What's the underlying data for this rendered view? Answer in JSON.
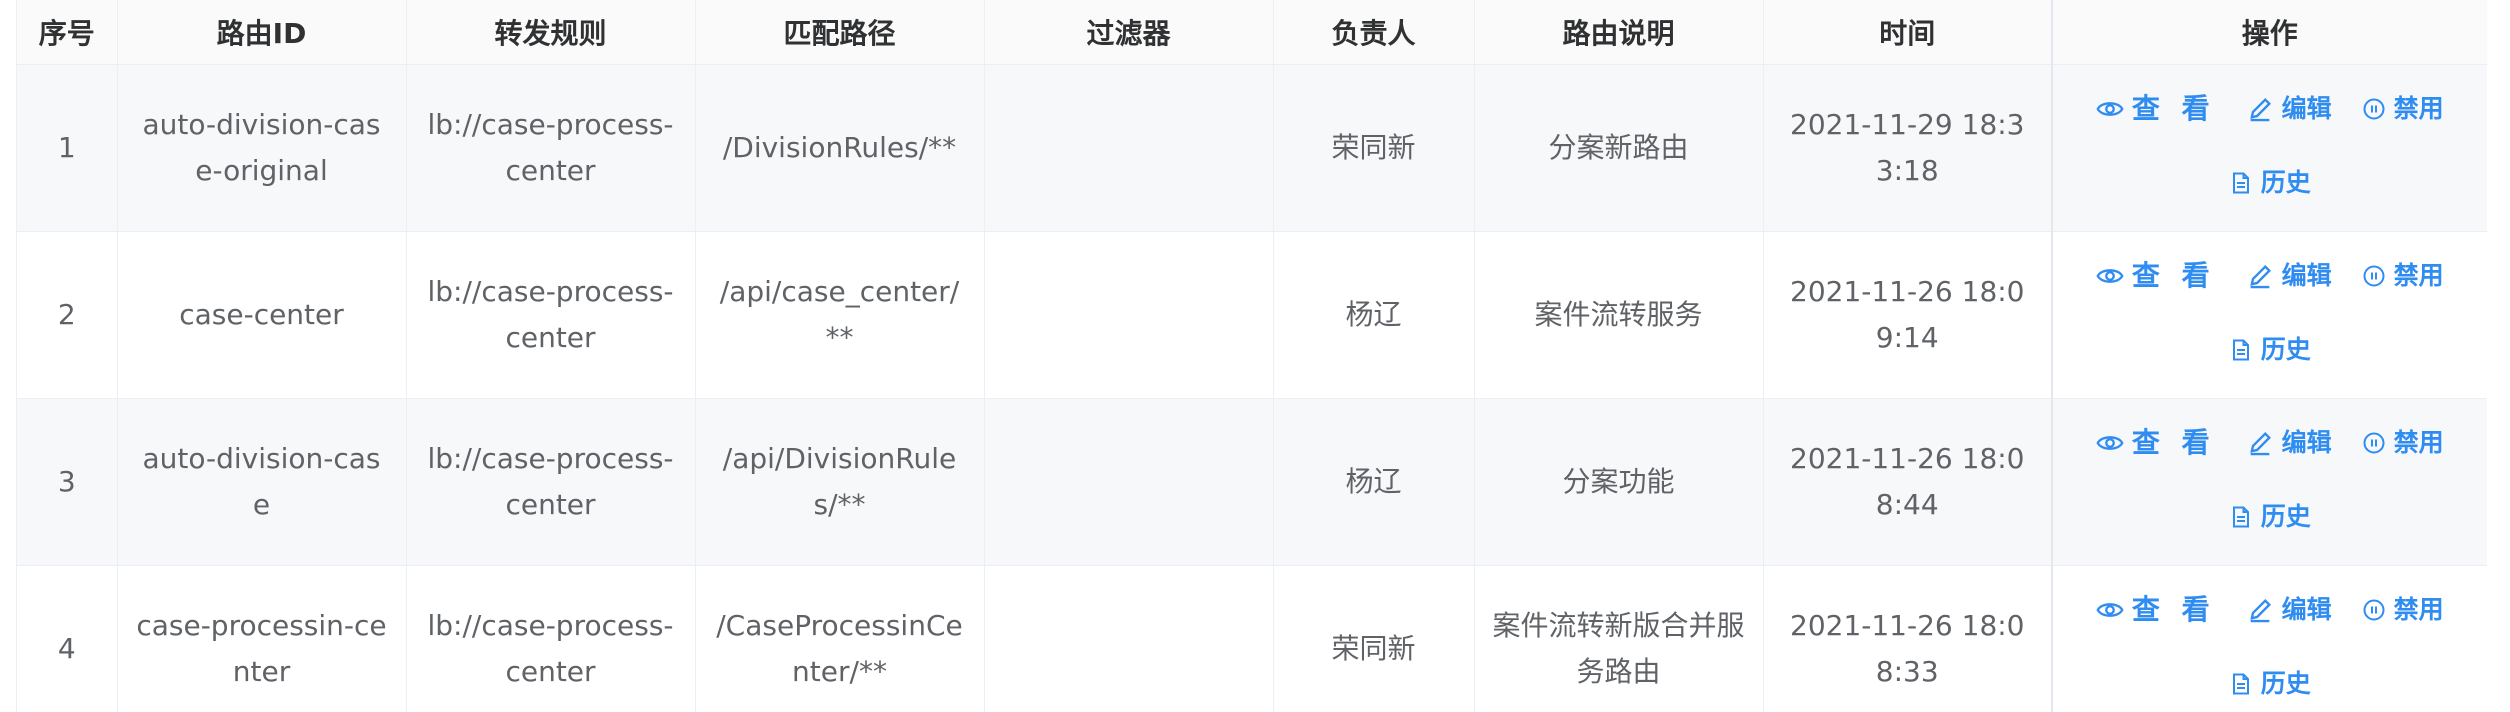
{
  "headers": [
    "序号",
    "路由ID",
    "转发规则",
    "匹配路径",
    "过滤器",
    "负责人",
    "路由说明",
    "时间",
    "操作"
  ],
  "actions": {
    "view": "查 看",
    "edit": "编辑",
    "disable": "禁用",
    "history": "历史"
  },
  "rows": [
    {
      "index": "1",
      "route_id": "auto-division-case-original",
      "forward_rule": "lb://case-process-center",
      "match_path": "/DivisionRules/**",
      "filter": "",
      "owner": "荣同新",
      "description": "分案新路由",
      "time": "2021-11-29 18:33:18"
    },
    {
      "index": "2",
      "route_id": "case-center",
      "forward_rule": "lb://case-process-center",
      "match_path": "/api/case_center/**",
      "filter": "",
      "owner": "杨辽",
      "description": "案件流转服务",
      "time": "2021-11-26 18:09:14"
    },
    {
      "index": "3",
      "route_id": "auto-division-case",
      "forward_rule": "lb://case-process-center",
      "match_path": "/api/DivisionRules/**",
      "filter": "",
      "owner": "杨辽",
      "description": "分案功能",
      "time": "2021-11-26 18:08:44"
    },
    {
      "index": "4",
      "route_id": "case-processin-center",
      "forward_rule": "lb://case-process-center",
      "match_path": "/CaseProcessinCenter/**",
      "filter": "",
      "owner": "荣同新",
      "description": "案件流转新版合并服务路由",
      "time": "2021-11-26 18:08:33"
    }
  ]
}
